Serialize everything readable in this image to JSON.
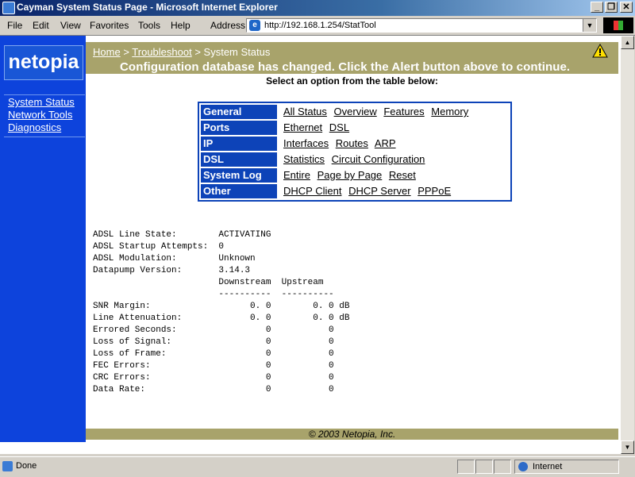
{
  "window": {
    "title": "Cayman System Status Page - Microsoft Internet Explorer"
  },
  "menu": [
    "File",
    "Edit",
    "View",
    "Favorites",
    "Tools",
    "Help"
  ],
  "address": {
    "label": "Address",
    "url": "http://192.168.1.254/StatTool"
  },
  "sidebar": {
    "logo": "netopia",
    "links": [
      "System Status",
      "Network Tools",
      "Diagnostics"
    ]
  },
  "breadcrumb": {
    "home": "Home",
    "sep1": ">",
    "troubleshoot": "Troubleshoot",
    "sep2": ">",
    "current": "System Status"
  },
  "alert": "Configuration database has changed. Click the Alert button above to continue.",
  "instruction": "Select an option from the table below:",
  "options": [
    {
      "label": "General",
      "links": [
        "All Status",
        "Overview",
        "Features",
        "Memory"
      ]
    },
    {
      "label": "Ports",
      "links": [
        "Ethernet",
        "DSL"
      ]
    },
    {
      "label": "IP",
      "links": [
        "Interfaces",
        "Routes",
        "ARP"
      ]
    },
    {
      "label": "DSL",
      "links": [
        "Statistics",
        "Circuit Configuration"
      ]
    },
    {
      "label": "System Log",
      "links": [
        "Entire",
        "Page by Page",
        "Reset"
      ]
    },
    {
      "label": "Other",
      "links": [
        "DHCP Client",
        "DHCP Server",
        "PPPoE"
      ]
    }
  ],
  "stats_text": "ADSL Line State:        ACTIVATING\nADSL Startup Attempts:  0\nADSL Modulation:        Unknown\nDatapump Version:       3.14.3\n                        Downstream  Upstream\n                        ----------  ----------\nSNR Margin:                   0. 0        0. 0 dB\nLine Attenuation:             0. 0        0. 0 dB\nErrored Seconds:                 0           0\nLoss of Signal:                  0           0\nLoss of Frame:                   0           0\nFEC Errors:                      0           0\nCRC Errors:                      0           0\nData Rate:                       0           0",
  "footer": "© 2003 Netopia, Inc.",
  "status": {
    "text": "Done",
    "zone": "Internet"
  }
}
